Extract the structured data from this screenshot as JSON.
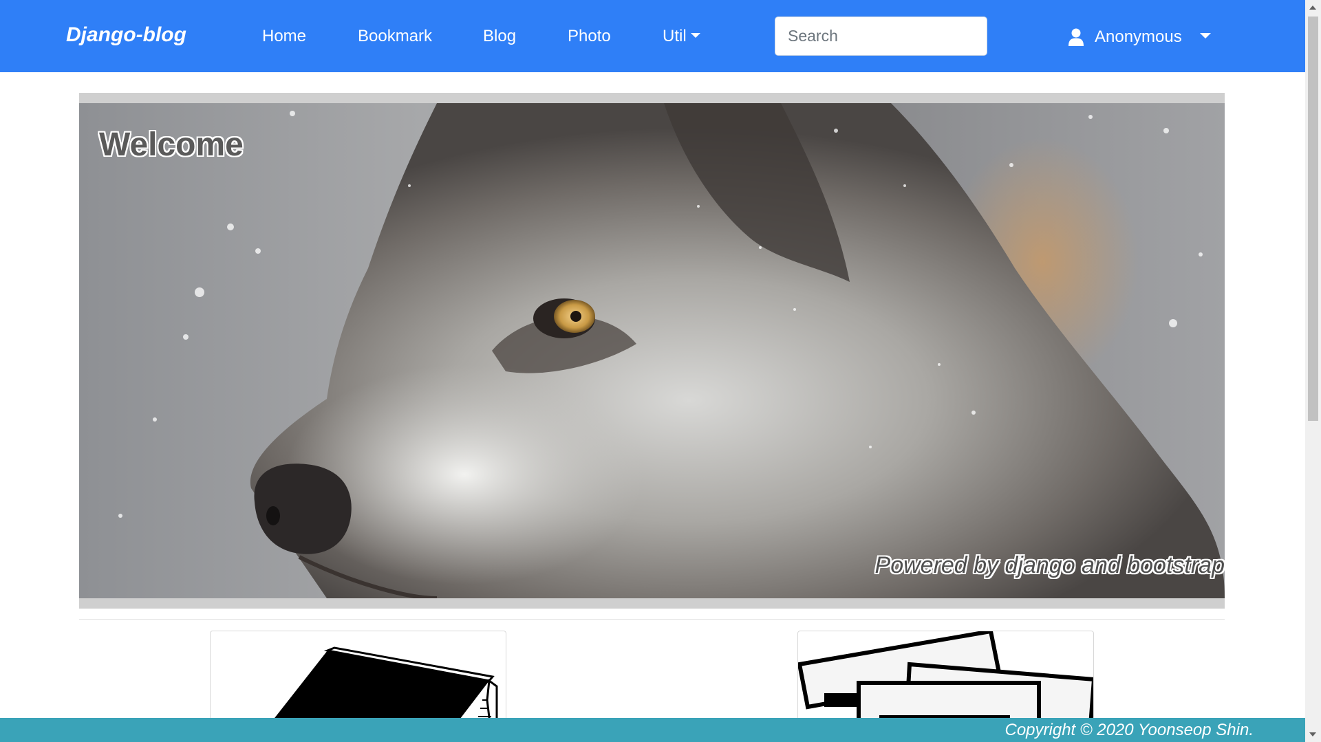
{
  "navbar": {
    "brand": "Django-blog",
    "items": [
      {
        "label": "Home"
      },
      {
        "label": "Bookmark"
      },
      {
        "label": "Blog"
      },
      {
        "label": "Photo"
      },
      {
        "label": "Util"
      }
    ],
    "search_placeholder": "Search",
    "user_label": "Anonymous",
    "background_color": "#2f7ff7"
  },
  "hero": {
    "title": "Welcome",
    "subtitle": "Powered by django and bootstrap",
    "image_alt": "wolf"
  },
  "cards": [
    {
      "icon": "book-icon"
    },
    {
      "icon": "photos-icon"
    }
  ],
  "footer": {
    "copyright": "Copyright © 2020 Yoonseop Shin.",
    "background_color": "#3aa3b8"
  }
}
